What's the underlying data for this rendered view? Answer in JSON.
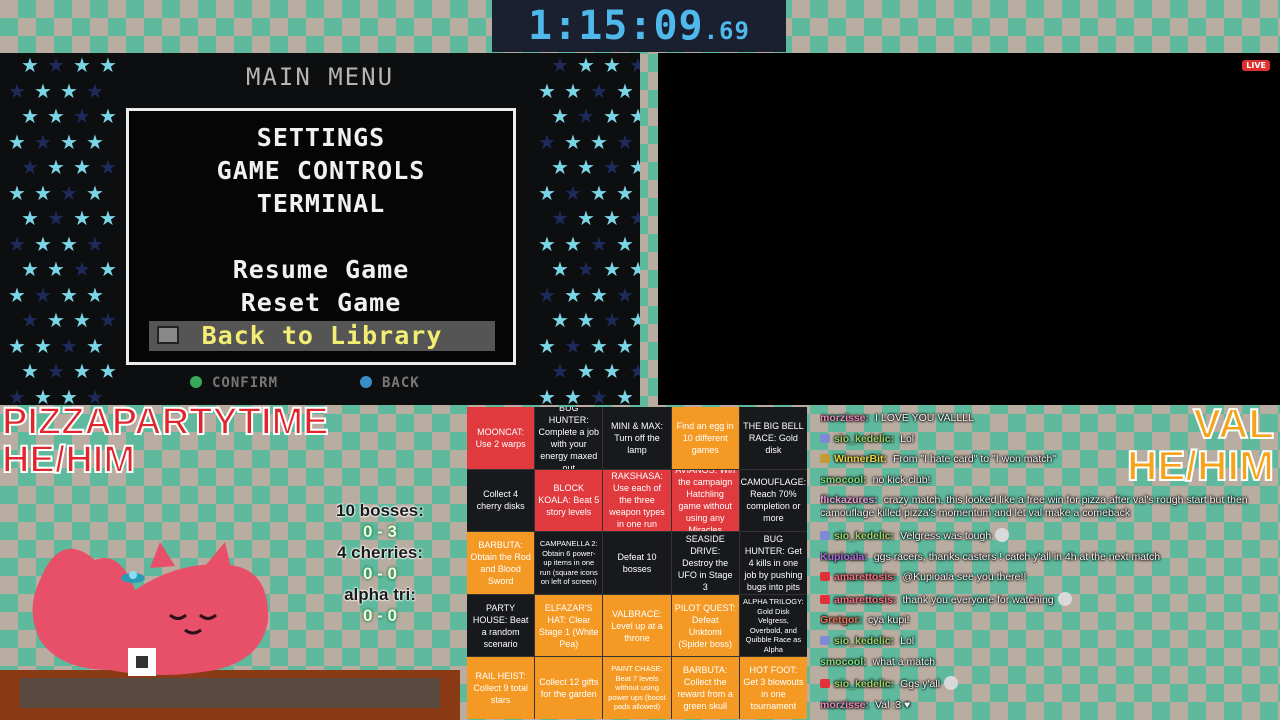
{
  "timer": {
    "main": "1:15:09",
    "ms": ".69"
  },
  "game": {
    "title": "MAIN  MENU",
    "menu": [
      "SETTINGS",
      "GAME  CONTROLS",
      "TERMINAL",
      "Resume  Game",
      "Reset Game",
      "Back to  Library"
    ],
    "hints": {
      "confirm": "CONFIRM",
      "back": "BACK"
    }
  },
  "stream": {
    "live": "LIVE"
  },
  "runners": {
    "left": {
      "name": "PIZZAPARTYTIME",
      "pronouns": "HE/HIM"
    },
    "right": {
      "name": "VAL",
      "pronouns": "HE/HIM"
    }
  },
  "stats": {
    "bosses_label": "10 bosses:",
    "bosses_value": "0 - 3",
    "cherries_label": "4 cherries:",
    "cherries_value": "0 - 0",
    "alpha_label": "alpha tri:",
    "alpha_value": "0 - 0"
  },
  "bingo": [
    {
      "text": "MOONCAT: Use 2 warps",
      "color": "red"
    },
    {
      "text": "BUG HUNTER: Complete a job with your energy maxed out",
      "color": "dark"
    },
    {
      "text": "MINI & MAX: Turn off the lamp",
      "color": "dark"
    },
    {
      "text": "Find an egg in 10 different games",
      "color": "orange"
    },
    {
      "text": "THE BIG BELL RACE: Gold disk",
      "color": "dark"
    },
    {
      "text": "Collect 4 cherry disks",
      "color": "dark"
    },
    {
      "text": "BLOCK KOALA: Beat 5 story levels",
      "color": "red"
    },
    {
      "text": "RAKSHASA: Use each of the three weapon types in one run",
      "color": "red"
    },
    {
      "text": "AVIANOS: Win the campaign Hatchling game without using any Miracles",
      "color": "red"
    },
    {
      "text": "CAMOUFLAGE: Reach 70% completion or more",
      "color": "dark"
    },
    {
      "text": "BARBUTA: Obtain the Rod and Blood Sword",
      "color": "orange"
    },
    {
      "text": "CAMPANELLA 2: Obtain 6 power-up items in one run (square icons on left of screen)",
      "color": "dark",
      "small": true
    },
    {
      "text": "Defeat 10 bosses",
      "color": "dark"
    },
    {
      "text": "SEASIDE DRIVE: Destroy the UFO in Stage 3",
      "color": "dark"
    },
    {
      "text": "BUG HUNTER: Get 4 kills in one job by pushing bugs into pits",
      "color": "dark"
    },
    {
      "text": "PARTY HOUSE: Beat a random scenario",
      "color": "dark"
    },
    {
      "text": "ELFAZAR'S HAT: Clear Stage 1 (White Pea)",
      "color": "orange"
    },
    {
      "text": "VALBRACE: Level up at a throne",
      "color": "orange"
    },
    {
      "text": "PILOT QUEST: Defeat Unktomi (Spider boss)",
      "color": "orange"
    },
    {
      "text": "ALPHA TRILOGY: Gold Disk Velgress, Overbold, and Quibble Race as Alpha",
      "color": "dark",
      "small": true
    },
    {
      "text": "RAIL HEIST: Collect 9 total stars",
      "color": "orange"
    },
    {
      "text": "Collect 12 gifts for the garden",
      "color": "orange"
    },
    {
      "text": "PAINT CHASE: Beat 7 levels without using power ups (boost pads allowed)",
      "color": "orange",
      "small": true
    },
    {
      "text": "BARBUTA: Collect the reward from a green skull",
      "color": "orange"
    },
    {
      "text": "HOT FOOT: Get 3 blowouts in one tournament",
      "color": "orange"
    }
  ],
  "chat": [
    {
      "user": "morzisse",
      "color": "#e58bb8",
      "text": "I LOVE YOU VALLLL",
      "badge": ""
    },
    {
      "user": "sio_kedelic",
      "color": "#9ad36a",
      "text": "Lol",
      "badge": "#7d8ad6"
    },
    {
      "user": "WinnerBit",
      "color": "#e8d545",
      "text": "From \"I hate card\" to \"I won match\"",
      "badge": "#c59a35"
    },
    {
      "user": "smocool",
      "color": "#7ee07e",
      "text": "no kick club!",
      "badge": ""
    },
    {
      "user": "flickazures",
      "color": "#e8a0d8",
      "text": "crazy match, this looked like a free win for pizza after val's rough start but then camouflage killed pizza's momentum and let val make a comeback",
      "badge": ""
    },
    {
      "user": "sio_kedelic",
      "color": "#9ad36a",
      "text": "Velgress was tough",
      "badge": "#7d8ad6",
      "emote": true
    },
    {
      "user": "Kupioala",
      "color": "#a86fd8",
      "text": "ggs racers, thanks casters ! catch y'all in 4h at the next match",
      "badge": ""
    },
    {
      "user": "amarettosis",
      "color": "#f3707e",
      "text": "@Kupioala see you there!!",
      "badge": "#e0303a"
    },
    {
      "user": "amarettosis",
      "color": "#f3707e",
      "text": "thank you everyone for watching",
      "badge": "#e0303a",
      "emote": true
    },
    {
      "user": "Gretgor",
      "color": "#e8725a",
      "text": "cya kupi!",
      "badge": ""
    },
    {
      "user": "sio_kedelic",
      "color": "#9ad36a",
      "text": "Lol",
      "badge": "#7d8ad6"
    },
    {
      "user": "smocool",
      "color": "#7ee07e",
      "text": "what a match",
      "badge": ""
    },
    {
      "user": "sio_kedelic",
      "color": "#9ad36a",
      "text": "Ggs y'all",
      "badge": "#e0303a",
      "emote": true
    },
    {
      "user": "morzisse",
      "color": "#e58bb8",
      "text": "Val :3 ♥",
      "badge": ""
    }
  ]
}
